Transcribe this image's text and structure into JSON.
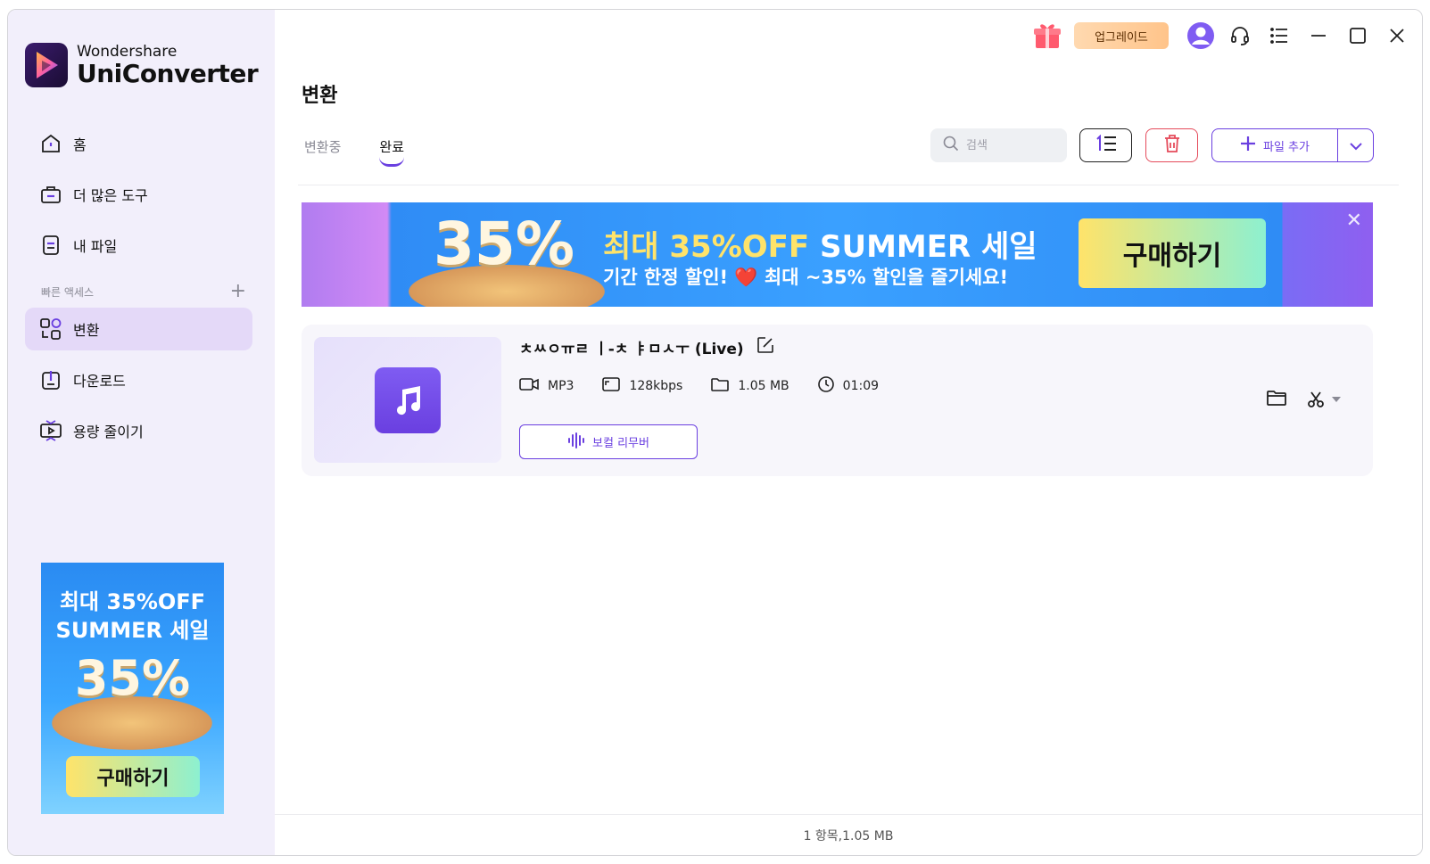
{
  "brand": {
    "sub": "Wondershare",
    "main": "UniConverter"
  },
  "sidebar": {
    "items": [
      {
        "label": "홈",
        "icon": "home-icon"
      },
      {
        "label": "더 많은 도구",
        "icon": "toolbox-icon"
      },
      {
        "label": "내 파일",
        "icon": "file-icon"
      },
      {
        "label": "변환",
        "icon": "convert-icon",
        "active": true
      },
      {
        "label": "다운로드",
        "icon": "download-icon"
      },
      {
        "label": "용량 줄이기",
        "icon": "compress-icon"
      }
    ],
    "quick_access_label": "빠른 액세스",
    "ad": {
      "line1": "최대 35%OFF",
      "line2": "SUMMER 세일",
      "big": "35%",
      "button": "구매하기"
    }
  },
  "titlebar": {
    "upgrade_label": "업그레이드"
  },
  "page": {
    "title": "변환"
  },
  "tabs": [
    {
      "label": "변환중"
    },
    {
      "label": "완료",
      "active": true
    }
  ],
  "toolbar": {
    "search_placeholder": "검색",
    "add_file_label": "파일 추가"
  },
  "banner": {
    "big": "35%",
    "headline_yellow": "최대 35%OFF",
    "headline_white": "SUMMER 세일",
    "subline": "기간 한정 할인! ❤️ 최대 ~35% 할인을 즐기세요!",
    "button": "구매하기",
    "close": "✕"
  },
  "file": {
    "name": "ㅊㅆㅇㅠㄹ ㅣ-ㅊ ㅑㅁㅅㅜ (Live)",
    "format": "MP3",
    "bitrate": "128kbps",
    "size": "1.05 MB",
    "duration": "01:09",
    "vocal_remover_label": "보컬 리무버"
  },
  "status": {
    "summary": "1 항목,1.05 MB"
  },
  "colors": {
    "accent": "#6a3fe0",
    "danger": "#e54b5b",
    "sidebar_bg": "#f2effb",
    "active_bg": "#e4d9f8"
  }
}
